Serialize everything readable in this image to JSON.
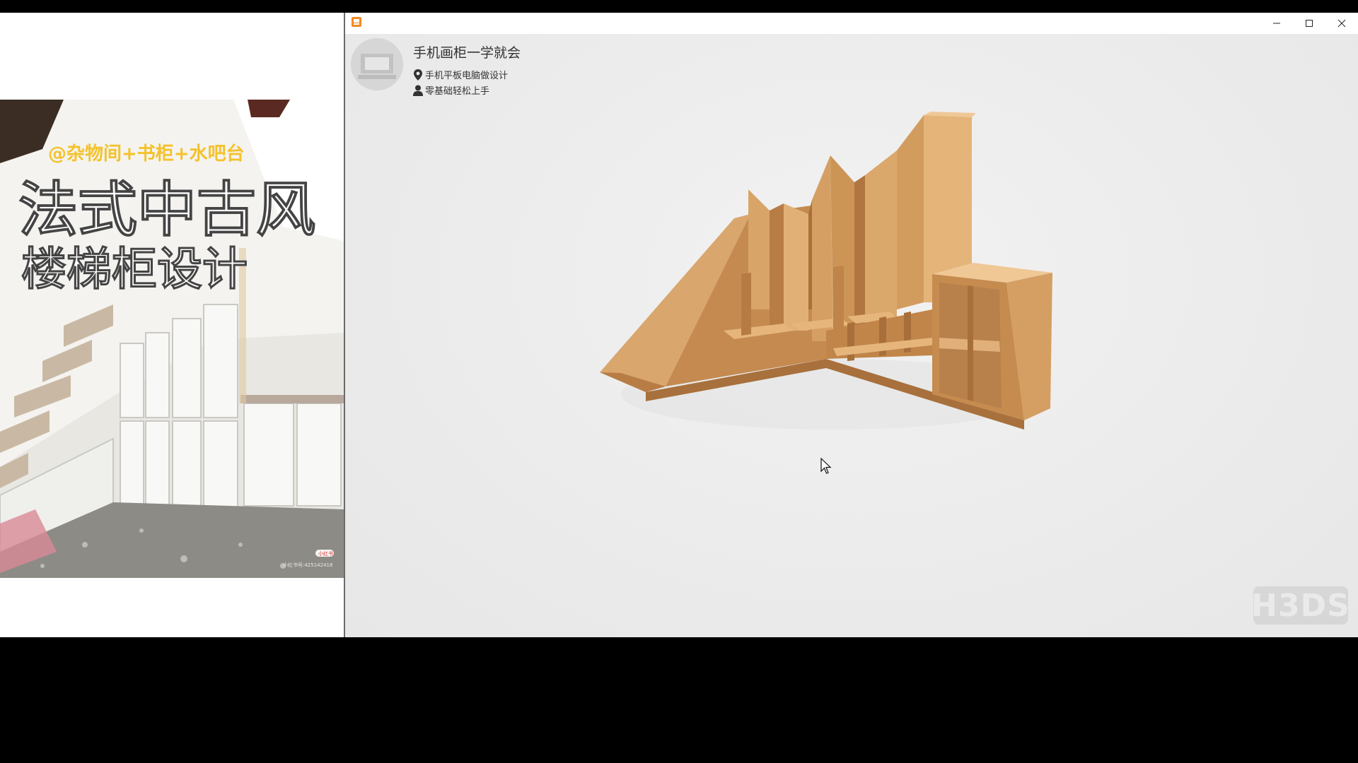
{
  "reference_photo": {
    "tag_line": "@杂物间+书柜+水吧台",
    "title_line_1": "法式中古风",
    "title_line_2": "楼梯柜设计",
    "corner_badge": "小红书",
    "corner_id": "小红书号:425142418"
  },
  "app": {
    "profile": {
      "title": "手机画柜一学就会",
      "line_1": "手机平板电脑做设计",
      "line_2": "零基础轻松上手"
    },
    "watermark": "H3DS"
  },
  "colors": {
    "wood_light": "#e3b27a",
    "wood_mid": "#c98f55",
    "wood_dark": "#a8703c",
    "title_yellow": "#f4c22b"
  }
}
